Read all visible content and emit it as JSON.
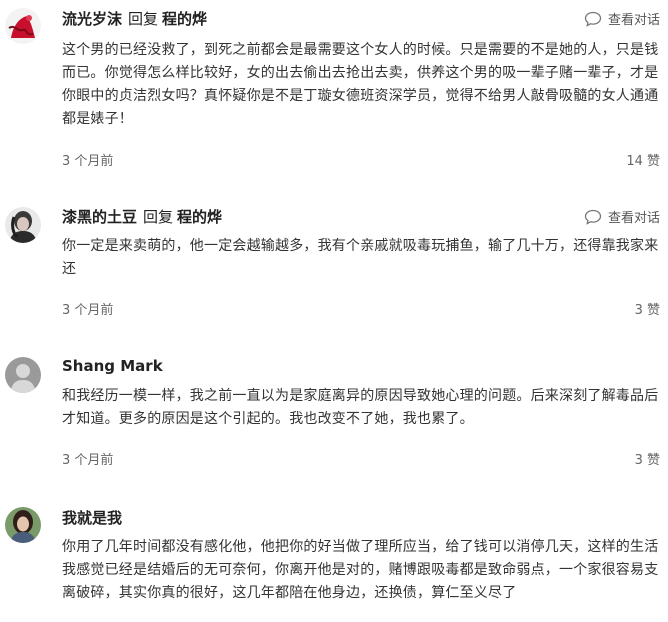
{
  "labels": {
    "reply": "回复",
    "view_dialog": "查看对话"
  },
  "comments": [
    {
      "user": "流光岁沫",
      "reply_to": "程的烨",
      "text": "这个男的已经没救了，到死之前都会是最需要这个女人的时候。只是需要的不是她的人，只是钱而已。你觉得怎么样比较好，女的出去偷出去抢出去卖，供养这个男的吸一辈子赌一辈子，才是你眼中的贞洁烈女吗？真怀疑你是不是丁璇女德班资深学员，觉得不给男人敲骨吸髓的女人通通都是婊子！",
      "time": "3 个月前",
      "likes": "14 赞"
    },
    {
      "user": "漆黑的土豆",
      "reply_to": "程的烨",
      "text": "你一定是来卖萌的，他一定会越输越多，我有个亲戚就吸毒玩捕鱼，输了几十万，还得靠我家来还",
      "time": "3 个月前",
      "likes": "3 赞"
    },
    {
      "user": "Shang Mark",
      "reply_to": "",
      "text": "和我经历一模一样，我之前一直以为是家庭离异的原因导致她心理的问题。后来深刻了解毒品后才知道。更多的原因是这个引起的。我也改变不了她，我也累了。",
      "time": "3 个月前",
      "likes": "3 赞"
    },
    {
      "user": "我就是我",
      "reply_to": "",
      "text": "你用了几年时间都没有感化他，他把你的好当做了理所应当，给了钱可以消停几天，这样的生活我感觉已经是结婚后的无可奈何，你离开他是对的，赌博跟吸毒都是致命弱点，一个家很容易支离破碎，其实你真的很好，这几年都陪在他身边，还换债，算仁至义尽了",
      "time": "",
      "likes": ""
    }
  ]
}
